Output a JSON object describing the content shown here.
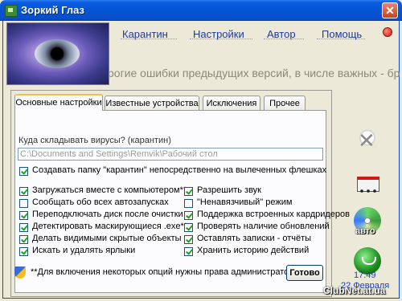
{
  "window": {
    "title": "Зоркий Глаз"
  },
  "nav": {
    "items": [
      "Карантин",
      "Настройки",
      "Автор",
      "Помощь"
    ]
  },
  "ticker": "рогие ошибки предыдущих версий, в числе важных - бро",
  "tabs": [
    "Основные настройки",
    "Известные устройства",
    "Исключения",
    "Прочее"
  ],
  "settings": {
    "quarantine_label": "Куда складывать вирусы? (карантин)",
    "quarantine_path": "C:\\Documents and Settings\\Remvik\\Рабочий стол",
    "create_folder": {
      "label": "Создавать папку \"карантин\" непосредственно на вылеченных флешках",
      "checked": true
    },
    "left_options": [
      {
        "label": "Загружаться вместе с компьютером**",
        "checked": true
      },
      {
        "label": "Сообщать обо всех автозапусках",
        "checked": false
      },
      {
        "label": "Переподключать диск после очистки",
        "checked": true
      },
      {
        "label": "Детектировать маскирующиеся .exe**",
        "checked": true
      },
      {
        "label": "Делать видимыми скрытые объекты",
        "checked": true
      },
      {
        "label": "Искать и удалять ярлыки",
        "checked": true
      }
    ],
    "right_options": [
      {
        "label": "Разрешить звук",
        "checked": true
      },
      {
        "label": "\"Ненавязчивый\" режим",
        "checked": false
      },
      {
        "label": "Поддержка встроенных кардридеров",
        "checked": true
      },
      {
        "label": "Проверять наличие обновлений",
        "checked": true
      },
      {
        "label": "Оставлять записки - отчёты",
        "checked": true
      },
      {
        "label": "Хранить историю действий",
        "checked": true
      }
    ],
    "admin_note": "**Для включения некоторых опций нужны права администратора",
    "ok_button": "Готово"
  },
  "sidebar": {
    "icons": [
      "skull-icon",
      "truck-icon",
      "autorun-cd-icon",
      "globe-icon"
    ],
    "auto_label": "авто"
  },
  "clock": {
    "time": "17:49",
    "date": "22 Февраля"
  },
  "watermark": "ClubNet.at.ua"
}
